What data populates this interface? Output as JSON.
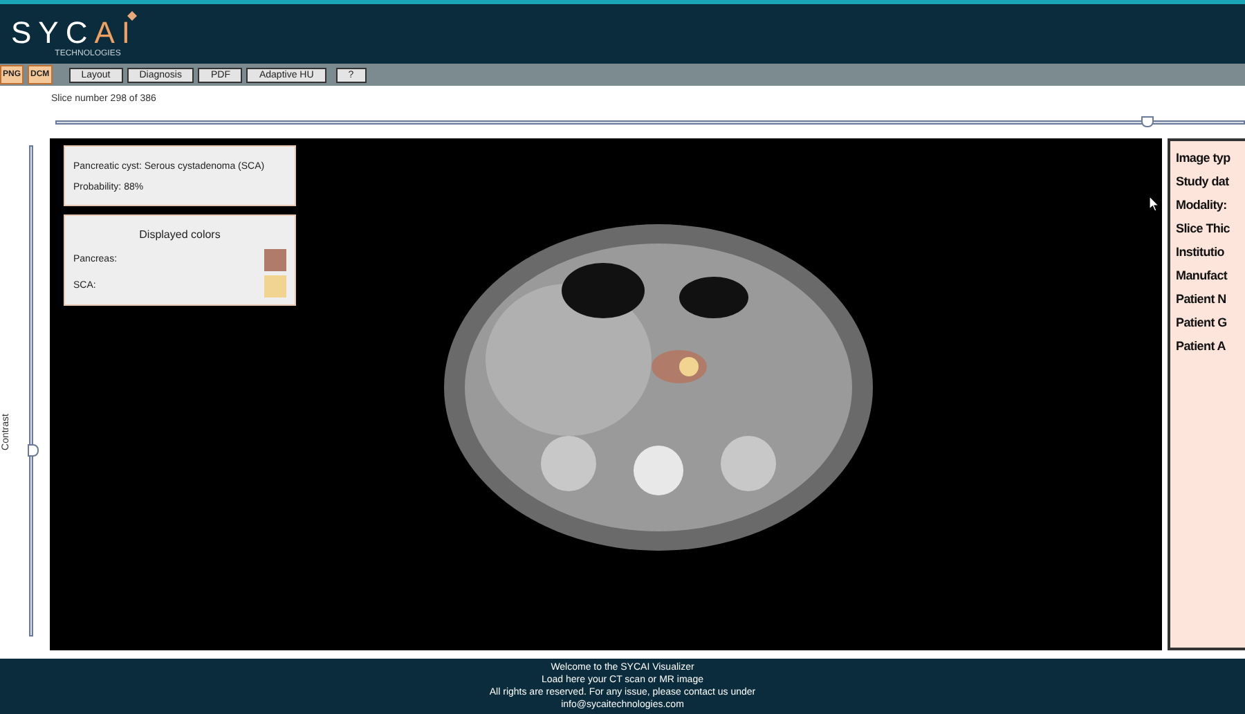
{
  "header": {
    "logo": {
      "letters": "SYC",
      "accent": "AI",
      "subtitle": "TECHNOLOGIES"
    }
  },
  "toolbar": {
    "file_buttons": [
      "PNG",
      "DCM"
    ],
    "buttons": [
      "Layout",
      "Diagnosis",
      "PDF",
      "Adaptive HU",
      "?"
    ]
  },
  "slice": {
    "label": "Slice number 298 of 386",
    "level": 0.92
  },
  "contrast": {
    "label": "Contrast",
    "level": 0.38
  },
  "diagnosis": {
    "result": "Pancreatic cyst: Serous cystadenoma (SCA)",
    "probability": "Probability: 88%"
  },
  "legend": {
    "title": "Displayed colors",
    "items": [
      {
        "label": "Pancreas:",
        "color": "#b07b68"
      },
      {
        "label": "SCA:",
        "color": "#f0d490"
      }
    ]
  },
  "info_panel": {
    "fields": [
      "Image typ",
      "Study dat",
      "Modality:",
      "Slice Thic",
      "Institutio",
      "Manufact",
      "Patient N",
      "Patient G",
      "Patient A"
    ]
  },
  "footer": {
    "lines": [
      "Welcome to the SYCAI Visualizer",
      "Load here your CT scan or MR image",
      "All rights are reserved. For any issue, please contact us under"
    ],
    "email": "info@sycaitechnologies.com"
  }
}
